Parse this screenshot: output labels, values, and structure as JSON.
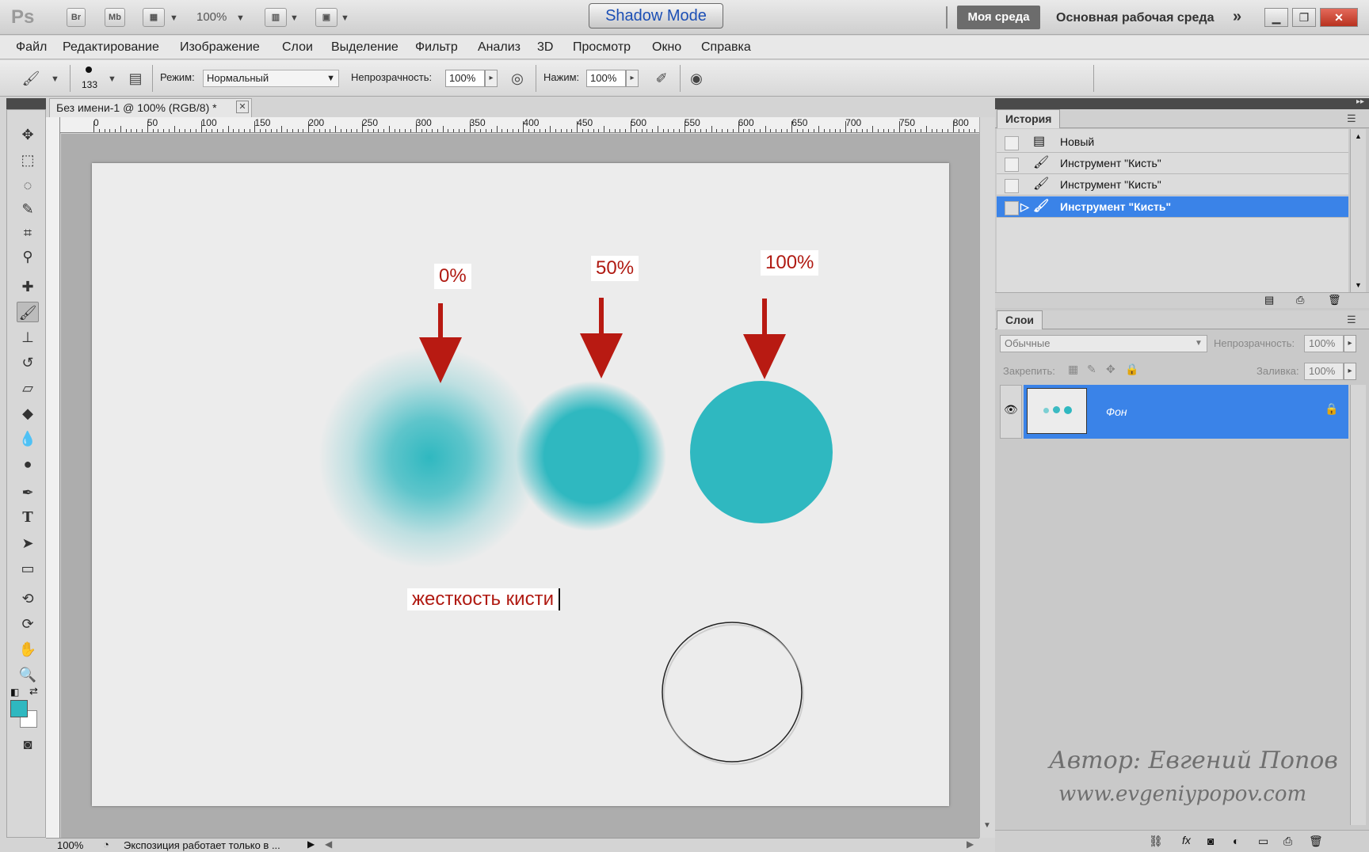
{
  "app": {
    "logo": "Ps",
    "bridge": "Br",
    "minibridge": "Mb",
    "zoom": "100%",
    "shadow_mode": "Shadow Mode",
    "workspace_mine": "Моя среда",
    "workspace_main": "Основная рабочая среда",
    "more": "»"
  },
  "menu": [
    "Файл",
    "Редактирование",
    "Изображение",
    "Слои",
    "Выделение",
    "Фильтр",
    "Анализ",
    "3D",
    "Просмотр",
    "Окно",
    "Справка"
  ],
  "options": {
    "brush_size": "133",
    "mode_label": "Режим:",
    "mode_value": "Нормальный",
    "opacity_label": "Непрозрачность:",
    "opacity_value": "100%",
    "flow_label": "Нажим:",
    "flow_value": "100%"
  },
  "document": {
    "tab_title": "Без имени-1 @ 100% (RGB/8) *",
    "ruler_top": [
      "0",
      "50",
      "100",
      "150",
      "200",
      "250",
      "300",
      "350",
      "400",
      "450",
      "500",
      "550",
      "600",
      "650",
      "700",
      "750",
      "800"
    ],
    "labels": {
      "soft": "0%",
      "medium": "50%",
      "hard": "100%"
    },
    "hint": "жесткость кисти",
    "circle_color": "#2fb8c0",
    "annotation_color": "#b01a12"
  },
  "status": {
    "zoom": "100%",
    "message": "Экспозиция работает только в ..."
  },
  "history": {
    "tab": "История",
    "items": [
      {
        "label": "Новый",
        "selected": false
      },
      {
        "label": "Инструмент \"Кисть\"",
        "selected": false
      },
      {
        "label": "Инструмент \"Кисть\"",
        "selected": false
      },
      {
        "label": "Инструмент \"Кисть\"",
        "selected": true
      }
    ]
  },
  "layers": {
    "tab": "Слои",
    "blend": "Обычные",
    "opacity_label": "Непрозрачность:",
    "opacity_value": "100%",
    "lock_label": "Закрепить:",
    "fill_label": "Заливка:",
    "fill_value": "100%",
    "layer_name": "Фон"
  },
  "watermark": {
    "line1": "Автор: Евгений Попов",
    "line2": "www.evgeniypopov.com"
  }
}
